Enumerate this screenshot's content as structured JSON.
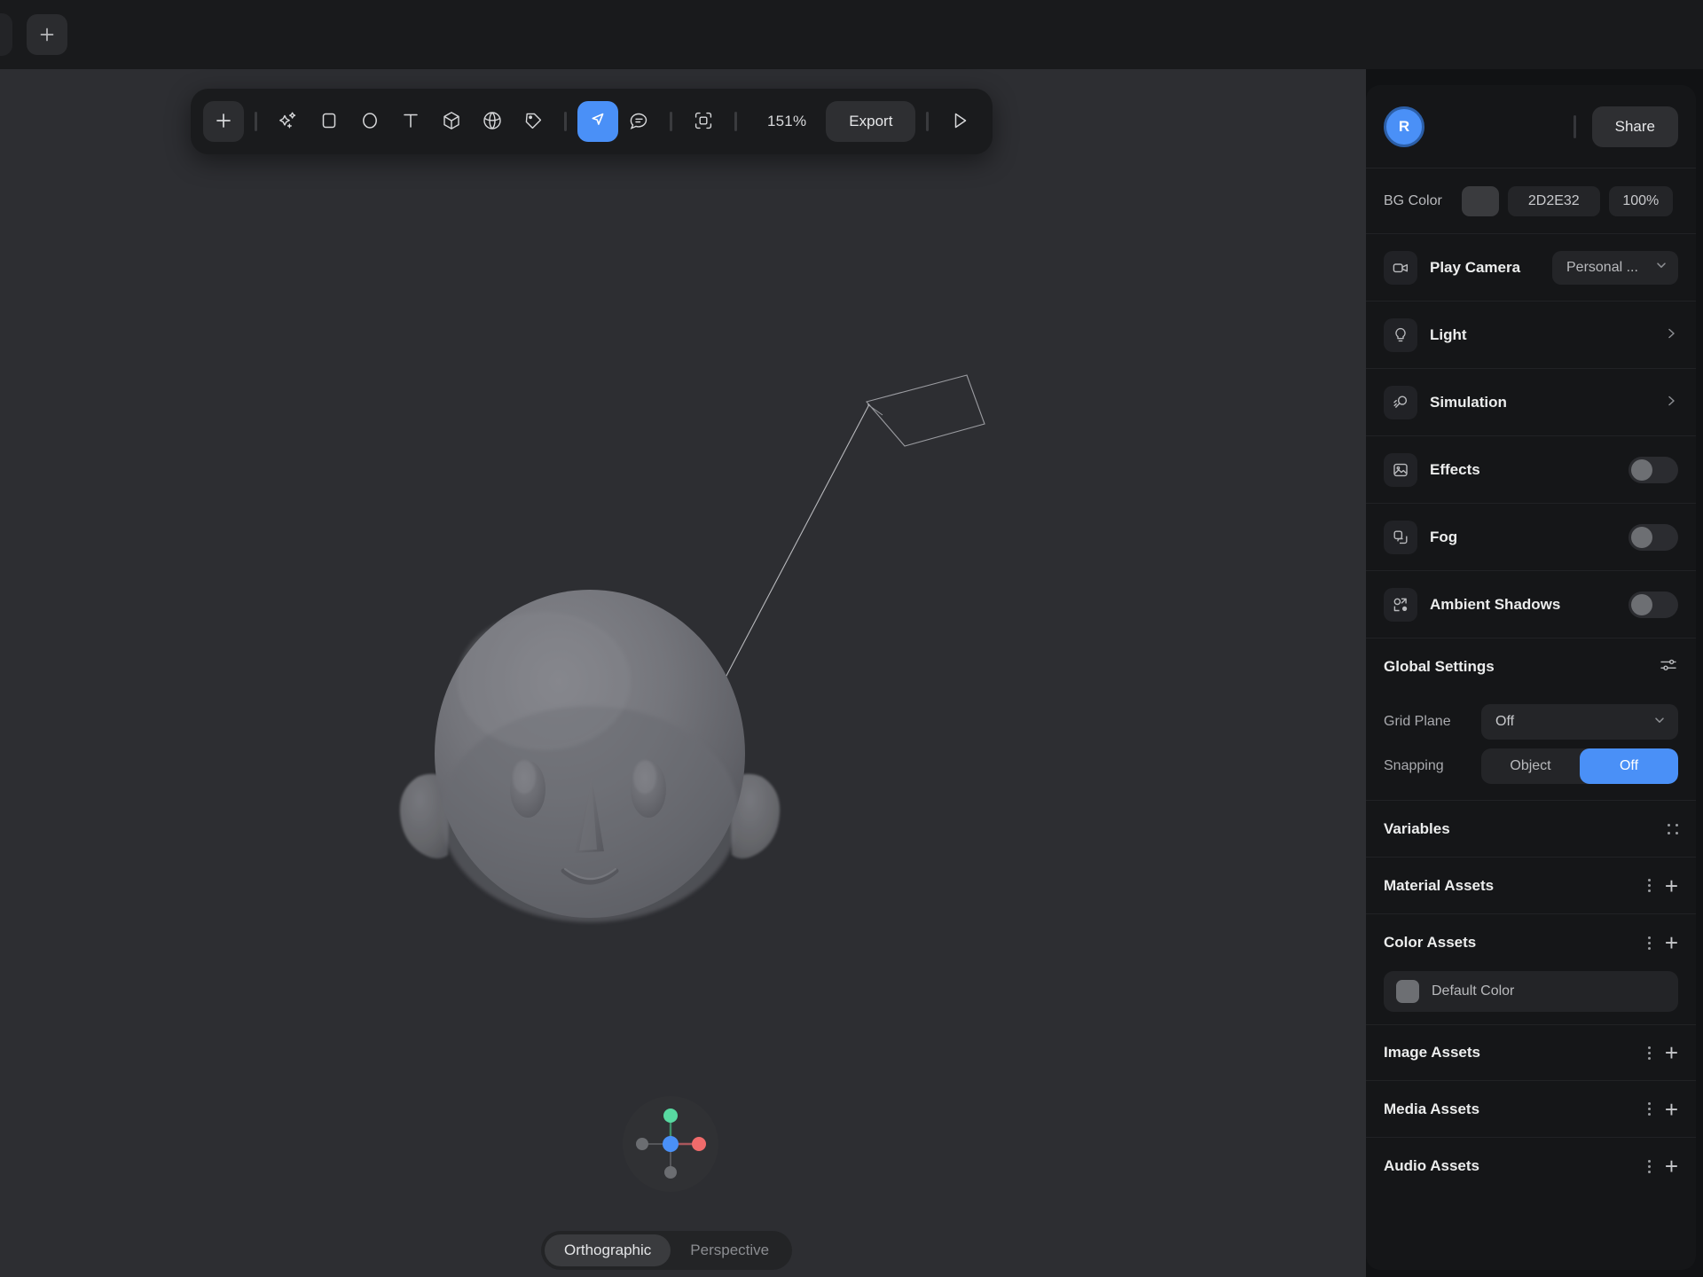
{
  "titlebar": {
    "add_tab_label": "+",
    "add_tab_icon": "plus-icon"
  },
  "toolbar": {
    "add_label": "+",
    "zoom_level": "151%",
    "export_label": "Export",
    "items": [
      {
        "name": "add-tool",
        "icon": "plus-icon"
      },
      {
        "name": "ai-tool",
        "icon": "sparkle-plus-icon"
      },
      {
        "name": "rectangle-tool",
        "icon": "square-icon"
      },
      {
        "name": "ellipse-tool",
        "icon": "circle-icon"
      },
      {
        "name": "text-tool",
        "icon": "text-t-icon"
      },
      {
        "name": "cube-tool",
        "icon": "cube-icon"
      },
      {
        "name": "sphere-tool",
        "icon": "sphere-icon"
      },
      {
        "name": "pen-tool",
        "icon": "pen-tag-icon"
      },
      {
        "name": "select-tool",
        "icon": "cursor-arrow-icon"
      },
      {
        "name": "comment-tool",
        "icon": "comment-bubble-icon"
      },
      {
        "name": "frame-tool",
        "icon": "frame-crop-icon"
      },
      {
        "name": "play-button",
        "icon": "play-triangle-icon"
      }
    ]
  },
  "viewport": {
    "projection": {
      "orthographic_label": "Orthographic",
      "perspective_label": "Perspective",
      "selected": "Orthographic"
    },
    "axis_gizmo": {
      "icon": "axis-gizmo-icon",
      "axes": [
        {
          "name": "y-positive",
          "color": "#58d9a1"
        },
        {
          "name": "x-positive",
          "color": "#f06b6b"
        },
        {
          "name": "origin",
          "color": "#4a90f7"
        },
        {
          "name": "x-negative",
          "color": "#6b6d71"
        },
        {
          "name": "y-negative",
          "color": "#6b6d71"
        }
      ]
    },
    "model": {
      "name": "head-3d-model",
      "surface_color": "#6d6e74"
    }
  },
  "panel": {
    "user": {
      "avatar_initial": "R",
      "accent": "#4a90f7"
    },
    "share_label": "Share",
    "bg_color": {
      "label": "BG Color",
      "hex": "2D2E32",
      "opacity": "100%",
      "swatch": "#3a3b3e"
    },
    "rows": [
      {
        "label": "Play Camera",
        "icon": "video-camera-icon",
        "control": "select",
        "value": "Personal ...",
        "chevron": "chevron-down-icon"
      },
      {
        "label": "Light",
        "icon": "lightbulb-icon",
        "control": "chevron",
        "chevron": "chevron-right-icon"
      },
      {
        "label": "Simulation",
        "icon": "magnifier-motion-icon",
        "control": "chevron",
        "chevron": "chevron-right-icon"
      },
      {
        "label": "Effects",
        "icon": "image-picture-icon",
        "control": "toggle",
        "on": false
      },
      {
        "label": "Fog",
        "icon": "layers-copy-icon",
        "control": "toggle",
        "on": false
      },
      {
        "label": "Ambient Shadows",
        "icon": "shapes-dot-icon",
        "control": "toggle",
        "on": false
      }
    ],
    "global_settings": {
      "title": "Global Settings",
      "settings_icon": "sliders-icon",
      "grid_plane": {
        "label": "Grid Plane",
        "value": "Off",
        "chevron": "chevron-down-icon"
      },
      "snapping": {
        "label": "Snapping",
        "options": [
          "Object",
          "Off"
        ],
        "selected": "Off"
      }
    },
    "sections": [
      {
        "title": "Variables",
        "actions": [
          "dot-grid-icon"
        ]
      },
      {
        "title": "Material Assets",
        "actions": [
          "kebab-menu-icon",
          "plus-icon"
        ]
      },
      {
        "title": "Color Assets",
        "actions": [
          "kebab-menu-icon",
          "plus-icon"
        ],
        "items": [
          {
            "name": "Default Color",
            "swatch": "#6d6f73"
          }
        ]
      },
      {
        "title": "Image Assets",
        "actions": [
          "kebab-menu-icon",
          "plus-icon"
        ]
      },
      {
        "title": "Media Assets",
        "actions": [
          "kebab-menu-icon",
          "plus-icon"
        ]
      },
      {
        "title": "Audio Assets",
        "actions": [
          "kebab-menu-icon",
          "plus-icon"
        ]
      }
    ]
  }
}
